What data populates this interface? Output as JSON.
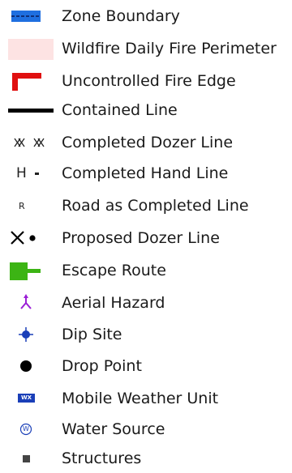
{
  "legend": {
    "items": [
      {
        "label": "Zone Boundary",
        "icon": "zone-boundary-icon",
        "color": "#1f6fe0"
      },
      {
        "label": "Wildfire Daily Fire Perimeter",
        "icon": "fire-perimeter-icon",
        "color": "#fde3e3"
      },
      {
        "label": "Uncontrolled Fire Edge",
        "icon": "uncontrolled-fire-edge-icon",
        "color": "#e01010"
      },
      {
        "label": "Contained Line",
        "icon": "contained-line-icon",
        "color": "#000000"
      },
      {
        "label": "Completed Dozer Line",
        "icon": "completed-dozer-line-icon",
        "color": "#222222"
      },
      {
        "label": "Completed Hand Line",
        "icon": "completed-hand-line-icon",
        "color": "#222222",
        "glyph_text": "H"
      },
      {
        "label": "Road as Completed Line",
        "icon": "road-completed-line-icon",
        "color": "#222222",
        "glyph_text": "R"
      },
      {
        "label": "Proposed Dozer Line",
        "icon": "proposed-dozer-line-icon",
        "color": "#000000"
      },
      {
        "label": "Escape Route",
        "icon": "escape-route-icon",
        "color": "#3cb414"
      },
      {
        "label": "Aerial Hazard",
        "icon": "aerial-hazard-icon",
        "color": "#9b1fd6"
      },
      {
        "label": "Dip Site",
        "icon": "dip-site-icon",
        "color": "#1a3fb8"
      },
      {
        "label": "Drop Point",
        "icon": "drop-point-icon",
        "color": "#000000"
      },
      {
        "label": "Mobile Weather Unit",
        "icon": "mobile-weather-unit-icon",
        "color": "#1a3fb8",
        "glyph_text": "WX"
      },
      {
        "label": "Water Source",
        "icon": "water-source-icon",
        "color": "#1a3fb8",
        "glyph_text": "W"
      },
      {
        "label": "Structures",
        "icon": "structures-icon",
        "color": "#444444"
      }
    ]
  }
}
